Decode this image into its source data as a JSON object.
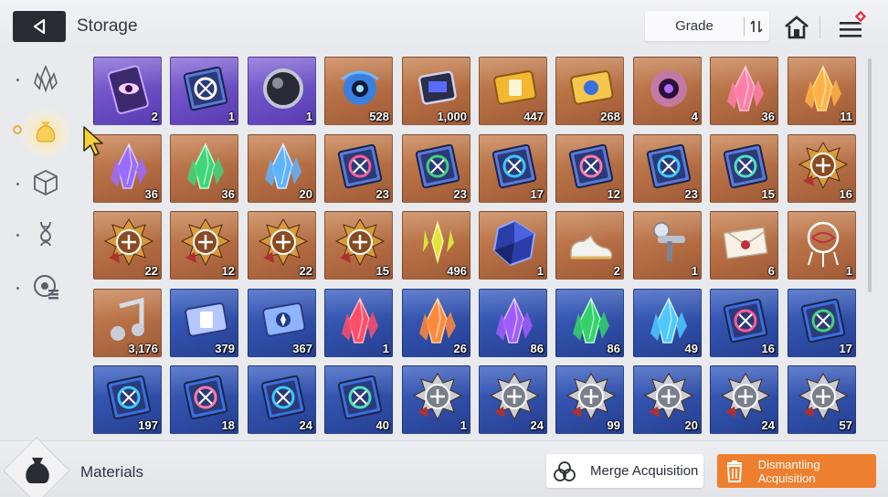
{
  "header": {
    "title": "Storage",
    "grade_label": "Grade"
  },
  "sidenav": {
    "items": [
      {
        "name": "crystal-category-icon",
        "active": false
      },
      {
        "name": "pouch-category-icon",
        "active": true
      },
      {
        "name": "cube-category-icon",
        "active": false
      },
      {
        "name": "dna-category-icon",
        "active": false
      },
      {
        "name": "disk-category-icon",
        "active": false
      }
    ]
  },
  "grid": {
    "columns": 10,
    "items": [
      {
        "icon": "eye-card",
        "rarity": "purple",
        "count": "2"
      },
      {
        "icon": "winged-book",
        "rarity": "purple",
        "count": "1"
      },
      {
        "icon": "dark-orb",
        "rarity": "purple",
        "count": "1"
      },
      {
        "icon": "blue-core",
        "rarity": "orange",
        "count": "528"
      },
      {
        "icon": "chip",
        "rarity": "orange",
        "count": "1,000"
      },
      {
        "icon": "gold-ticket",
        "rarity": "orange",
        "count": "447"
      },
      {
        "icon": "compass-ticket",
        "rarity": "orange",
        "count": "268"
      },
      {
        "icon": "eye-organ",
        "rarity": "orange",
        "count": "4"
      },
      {
        "icon": "crystal-pink",
        "rarity": "orange",
        "count": "36"
      },
      {
        "icon": "crystal-gold",
        "rarity": "orange",
        "count": "11"
      },
      {
        "icon": "crystal-purple",
        "rarity": "orange",
        "count": "36"
      },
      {
        "icon": "crystal-green",
        "rarity": "orange",
        "count": "36"
      },
      {
        "icon": "crystal-blue",
        "rarity": "orange",
        "count": "20"
      },
      {
        "icon": "book-swords",
        "rarity": "orange",
        "count": "23"
      },
      {
        "icon": "book-shield",
        "rarity": "orange",
        "count": "23"
      },
      {
        "icon": "book-eye",
        "rarity": "orange",
        "count": "17"
      },
      {
        "icon": "book-wings",
        "rarity": "orange",
        "count": "12"
      },
      {
        "icon": "book-bolt",
        "rarity": "orange",
        "count": "23"
      },
      {
        "icon": "book-flower",
        "rarity": "orange",
        "count": "15"
      },
      {
        "icon": "emblem-cross",
        "rarity": "orange",
        "count": "16"
      },
      {
        "icon": "emblem-shield",
        "rarity": "orange",
        "count": "22"
      },
      {
        "icon": "emblem-eye",
        "rarity": "orange",
        "count": "12"
      },
      {
        "icon": "emblem-bolt",
        "rarity": "orange",
        "count": "22"
      },
      {
        "icon": "emblem-flower",
        "rarity": "orange",
        "count": "15"
      },
      {
        "icon": "gold-shards",
        "rarity": "orange",
        "count": "496"
      },
      {
        "icon": "dark-cube",
        "rarity": "orange",
        "count": "1"
      },
      {
        "icon": "sneakers",
        "rarity": "orange",
        "count": "2"
      },
      {
        "icon": "spray-gun",
        "rarity": "orange",
        "count": "1"
      },
      {
        "icon": "letter",
        "rarity": "orange",
        "count": "6"
      },
      {
        "icon": "dreamcatcher",
        "rarity": "orange",
        "count": "1"
      },
      {
        "icon": "music-note",
        "rarity": "orange",
        "count": "3,176"
      },
      {
        "icon": "silver-ticket",
        "rarity": "blue",
        "count": "379"
      },
      {
        "icon": "blue-compass-ticket",
        "rarity": "blue",
        "count": "367"
      },
      {
        "icon": "shard-red",
        "rarity": "blue",
        "count": "1"
      },
      {
        "icon": "shard-orange",
        "rarity": "blue",
        "count": "26"
      },
      {
        "icon": "shard-purple",
        "rarity": "blue",
        "count": "86"
      },
      {
        "icon": "shard-green",
        "rarity": "blue",
        "count": "86"
      },
      {
        "icon": "shard-cyan",
        "rarity": "blue",
        "count": "49"
      },
      {
        "icon": "blue-book-swords",
        "rarity": "blue",
        "count": "16"
      },
      {
        "icon": "blue-book-shield",
        "rarity": "blue",
        "count": "17"
      },
      {
        "icon": "blue-book-eye",
        "rarity": "blue",
        "count": "197"
      },
      {
        "icon": "blue-book-wings",
        "rarity": "blue",
        "count": "18"
      },
      {
        "icon": "blue-book-bolt",
        "rarity": "blue",
        "count": "24"
      },
      {
        "icon": "blue-book-flower",
        "rarity": "blue",
        "count": "40"
      },
      {
        "icon": "silver-emblem-cross",
        "rarity": "blue",
        "count": "1"
      },
      {
        "icon": "silver-emblem-shield",
        "rarity": "blue",
        "count": "24"
      },
      {
        "icon": "silver-emblem-eye",
        "rarity": "blue",
        "count": "99"
      },
      {
        "icon": "silver-emblem-wings",
        "rarity": "blue",
        "count": "20"
      },
      {
        "icon": "silver-emblem-bolt",
        "rarity": "blue",
        "count": "24"
      },
      {
        "icon": "silver-emblem-flower",
        "rarity": "blue",
        "count": "57"
      }
    ]
  },
  "footer": {
    "category_label": "Materials",
    "merge_label": "Merge Acquisition",
    "dismantle_label": "Dismantling Acquisition"
  },
  "colors": {
    "rarity_purple": "#6a4fc4",
    "rarity_orange": "#b46d43",
    "rarity_blue": "#2f4fa8",
    "dismantle_button": "#ee7f2e"
  }
}
